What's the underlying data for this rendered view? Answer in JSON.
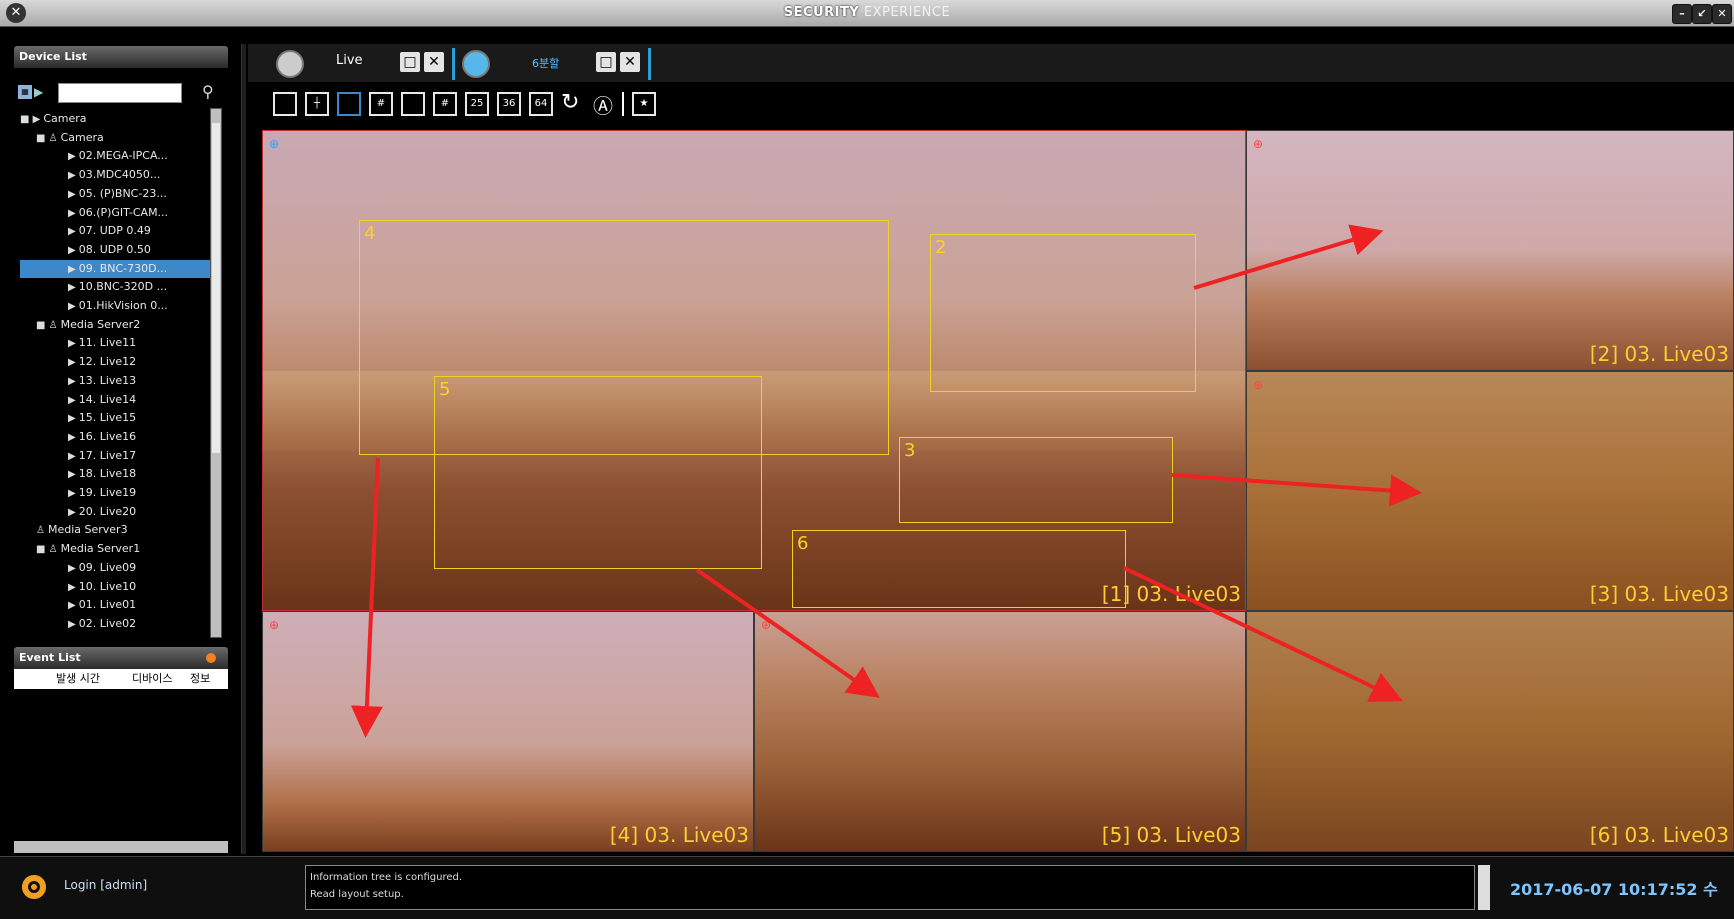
{
  "titlebar": {
    "title_bold": "SECURITY",
    "title_light": "EXPERIENCE",
    "min": "–",
    "restore": "↙",
    "close": "✕"
  },
  "device_list": {
    "header": "Device List"
  },
  "tree": [
    {
      "text": "Camera",
      "level": 0,
      "pre": "■"
    },
    {
      "text": "Camera",
      "level": 1,
      "pre": "■"
    },
    {
      "text": "02.MEGA-IPCA...",
      "level": 2
    },
    {
      "text": "03.MDC4050...",
      "level": 2
    },
    {
      "text": "05. (P)BNC-23...",
      "level": 2
    },
    {
      "text": "06.(P)GIT-CAM...",
      "level": 2
    },
    {
      "text": "07. UDP 0.49",
      "level": 2
    },
    {
      "text": "08. UDP 0.50",
      "level": 2
    },
    {
      "text": "09. BNC-730D...",
      "level": 2,
      "selected": true
    },
    {
      "text": "10.BNC-320D ...",
      "level": 2
    },
    {
      "text": "01.HikVision 0...",
      "level": 2
    },
    {
      "text": "Media Server2",
      "level": 1,
      "pre": "■"
    },
    {
      "text": "11. Live11",
      "level": 2
    },
    {
      "text": "12. Live12",
      "level": 2
    },
    {
      "text": "13. Live13",
      "level": 2
    },
    {
      "text": "14. Live14",
      "level": 2
    },
    {
      "text": "15. Live15",
      "level": 2
    },
    {
      "text": "16. Live16",
      "level": 2
    },
    {
      "text": "17. Live17",
      "level": 2
    },
    {
      "text": "18. Live18",
      "level": 2
    },
    {
      "text": "19. Live19",
      "level": 2
    },
    {
      "text": "20. Live20",
      "level": 2
    },
    {
      "text": "Media Server3",
      "level": 1
    },
    {
      "text": "Media Server1",
      "level": 1,
      "pre": "■"
    },
    {
      "text": "09. Live09",
      "level": 2
    },
    {
      "text": "10. Live10",
      "level": 2
    },
    {
      "text": "01. Live01",
      "level": 2
    },
    {
      "text": "02. Live02",
      "level": 2
    }
  ],
  "event_list": {
    "header": "Event List",
    "col_time": "발생 시간",
    "col_device": "디바이스",
    "col_info": "정보"
  },
  "tabs": {
    "live_label": "Live",
    "split_label": "6분할"
  },
  "layout_buttons": [
    "25",
    "36",
    "64"
  ],
  "cells": [
    {
      "label": "[1] 03. Live03"
    },
    {
      "label": "[2] 03. Live03"
    },
    {
      "label": "[3] 03. Live03"
    },
    {
      "label": "[4] 03. Live03"
    },
    {
      "label": "[5] 03. Live03"
    },
    {
      "label": "[6] 03. Live03"
    }
  ],
  "roi": [
    "4",
    "2",
    "5",
    "3",
    "6"
  ],
  "status": {
    "login": "Login [admin]",
    "msg1": "Information tree is configured.",
    "msg2": "Read layout setup.",
    "datetime": "2017-06-07 10:17:52 수"
  },
  "colors": {
    "accent": "#3d88c9",
    "label": "#ffcc33",
    "roi": "#f0d020",
    "arrow": "#ee2222"
  }
}
